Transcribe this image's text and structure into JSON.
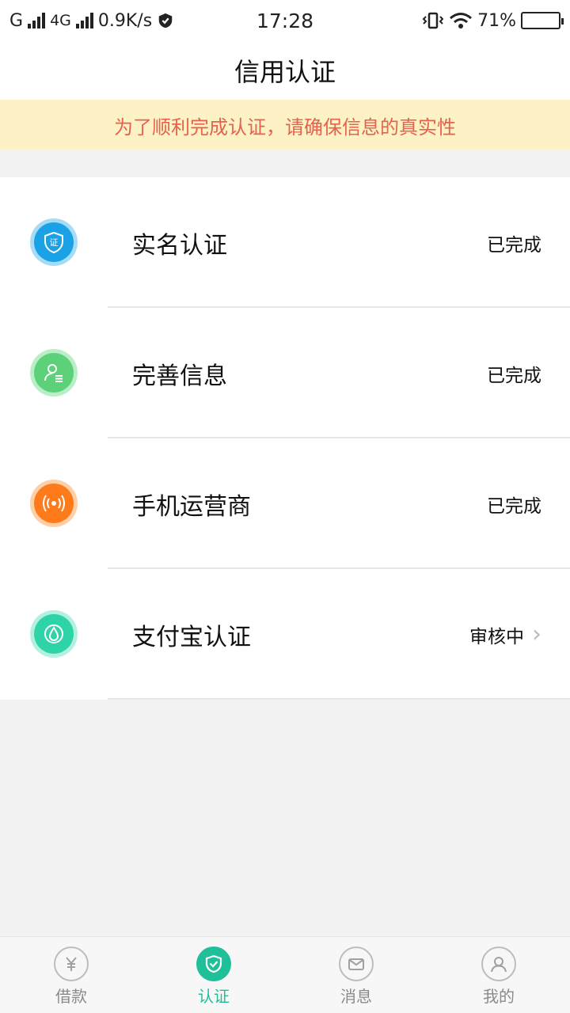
{
  "status_bar": {
    "carrier1": "G",
    "carrier2": "4G",
    "speed": "0.9K/s",
    "time": "17:28",
    "battery": "71%",
    "battery_level": 0.71
  },
  "nav": {
    "title": "信用认证"
  },
  "notice": {
    "text": "为了顺利完成认证，请确保信息的真实性"
  },
  "items": [
    {
      "title": "实名认证",
      "status": "已完成",
      "icon": "id-shield-icon",
      "color": "#1aa1e6",
      "ring": "#a6dcf5",
      "has_arrow": false
    },
    {
      "title": "完善信息",
      "status": "已完成",
      "icon": "user-profile-icon",
      "color": "#5dd07a",
      "ring": "#b9eec6",
      "has_arrow": false
    },
    {
      "title": "手机运营商",
      "status": "已完成",
      "icon": "signal-icon",
      "color": "#ff7a1a",
      "ring": "#ffcfa6",
      "has_arrow": false
    },
    {
      "title": "支付宝认证",
      "status": "审核中",
      "icon": "alipay-icon",
      "color": "#2ed3a8",
      "ring": "#b4f0df",
      "has_arrow": true
    }
  ],
  "tabs": [
    {
      "label": "借款",
      "icon": "yuan-icon",
      "active": false
    },
    {
      "label": "认证",
      "icon": "shield-check-icon",
      "active": true
    },
    {
      "label": "消息",
      "icon": "mail-icon",
      "active": false
    },
    {
      "label": "我的",
      "icon": "person-icon",
      "active": false
    }
  ],
  "colors": {
    "accent": "#1fbf9a",
    "notice_bg": "#fdf2c6",
    "notice_text": "#e5624d"
  }
}
